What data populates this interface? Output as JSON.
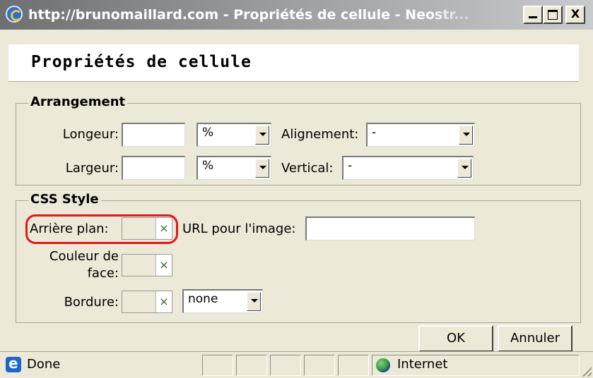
{
  "window": {
    "title": "http://brunomaillard.com - Propriétés de cellule - Neostr...",
    "minimize_label": "",
    "maximize_label": "",
    "close_label": "X"
  },
  "header": {
    "title": "Propriétés de cellule"
  },
  "arrangement": {
    "legend": "Arrangement",
    "longeur_label": "Longeur:",
    "longeur_value": "",
    "longeur_unit": "%",
    "alignement_label": "Alignement:",
    "alignement_value": "-",
    "largeur_label": "Largeur:",
    "largeur_value": "",
    "largeur_unit": "%",
    "vertical_label": "Vertical:",
    "vertical_value": "-"
  },
  "css_style": {
    "legend": "CSS Style",
    "arriere_plan_label": "Arrière plan:",
    "url_image_label": "URL pour l'image:",
    "url_image_value": "",
    "couleur_label_line1": "Couleur de",
    "couleur_label_line2": "face:",
    "bordure_label": "Bordure:",
    "bordure_style_value": "none",
    "clear_glyph": "×"
  },
  "buttons": {
    "ok": "OK",
    "annuler": "Annuler"
  },
  "statusbar": {
    "status_text": "Done",
    "zone_text": "Internet"
  },
  "colors": {
    "highlight": "#e01a1a",
    "dialog_bg": "#ece9d8"
  }
}
